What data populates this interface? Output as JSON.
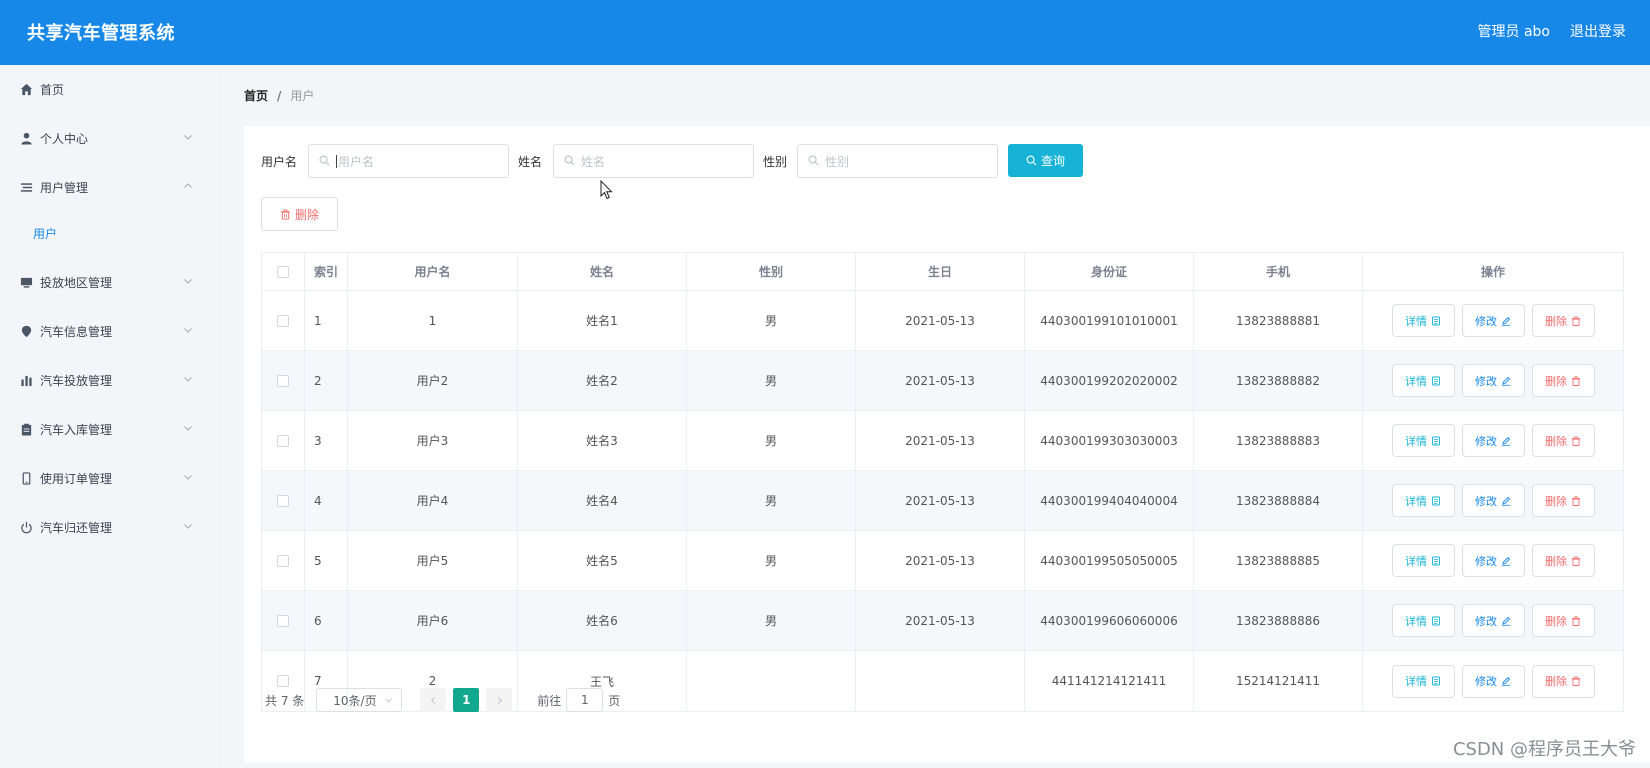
{
  "header": {
    "app_title": "共享汽车管理系统",
    "admin_label": "管理员 abo",
    "logout_label": "退出登录",
    "bg_color": "#1787e8"
  },
  "sidebar": {
    "items": [
      {
        "label": "首页",
        "icon": "home-icon"
      },
      {
        "label": "个人中心",
        "icon": "user-icon",
        "expanded": false
      },
      {
        "label": "用户管理",
        "icon": "list-icon",
        "expanded": true
      },
      {
        "label": "投放地区管理",
        "icon": "monitor-icon",
        "expanded": false
      },
      {
        "label": "汽车信息管理",
        "icon": "location-pin-icon",
        "expanded": false
      },
      {
        "label": "汽车投放管理",
        "icon": "bar-chart-icon",
        "expanded": false
      },
      {
        "label": "汽车入库管理",
        "icon": "clipboard-icon",
        "expanded": false
      },
      {
        "label": "使用订单管理",
        "icon": "phone-icon",
        "expanded": false
      },
      {
        "label": "汽车归还管理",
        "icon": "power-icon",
        "expanded": false
      }
    ],
    "sub_items": [
      {
        "label": "用户",
        "active": true
      }
    ]
  },
  "breadcrumb": {
    "home": "首页",
    "separator": "/",
    "current": "用户"
  },
  "search": {
    "username_label": "用户名",
    "username_placeholder": "用户名",
    "name_label": "姓名",
    "name_placeholder": "姓名",
    "gender_label": "性别",
    "gender_placeholder": "性别",
    "query_label": "查询",
    "query_color": "#16b3d7"
  },
  "toolbar": {
    "delete_label": "删除"
  },
  "table": {
    "columns": [
      "索引",
      "用户名",
      "姓名",
      "性别",
      "生日",
      "身份证",
      "手机",
      "操作"
    ],
    "rows": [
      {
        "idx": "1",
        "username": "1",
        "name": "姓名1",
        "gender": "男",
        "birthday": "2021-05-13",
        "id_card": "440300199101010001",
        "phone": "13823888881"
      },
      {
        "idx": "2",
        "username": "用户2",
        "name": "姓名2",
        "gender": "男",
        "birthday": "2021-05-13",
        "id_card": "440300199202020002",
        "phone": "13823888882"
      },
      {
        "idx": "3",
        "username": "用户3",
        "name": "姓名3",
        "gender": "男",
        "birthday": "2021-05-13",
        "id_card": "440300199303030003",
        "phone": "13823888883"
      },
      {
        "idx": "4",
        "username": "用户4",
        "name": "姓名4",
        "gender": "男",
        "birthday": "2021-05-13",
        "id_card": "440300199404040004",
        "phone": "13823888884"
      },
      {
        "idx": "5",
        "username": "用户5",
        "name": "姓名5",
        "gender": "男",
        "birthday": "2021-05-13",
        "id_card": "440300199505050005",
        "phone": "13823888885"
      },
      {
        "idx": "6",
        "username": "用户6",
        "name": "姓名6",
        "gender": "男",
        "birthday": "2021-05-13",
        "id_card": "440300199606060006",
        "phone": "13823888886"
      },
      {
        "idx": "7",
        "username": "2",
        "name": "王飞",
        "gender": "",
        "birthday": "",
        "id_card": "441141214121411",
        "phone": "15214121411"
      }
    ],
    "actions": {
      "detail": "详情",
      "edit": "修改",
      "delete": "删除"
    }
  },
  "pagination": {
    "total": "共 7 条",
    "page_size": "10条/页",
    "current_page": "1",
    "goto_prefix": "前往",
    "goto_value": "1",
    "goto_suffix": "页",
    "active_color": "#12a88f"
  },
  "watermark": "CSDN @程序员王大爷"
}
